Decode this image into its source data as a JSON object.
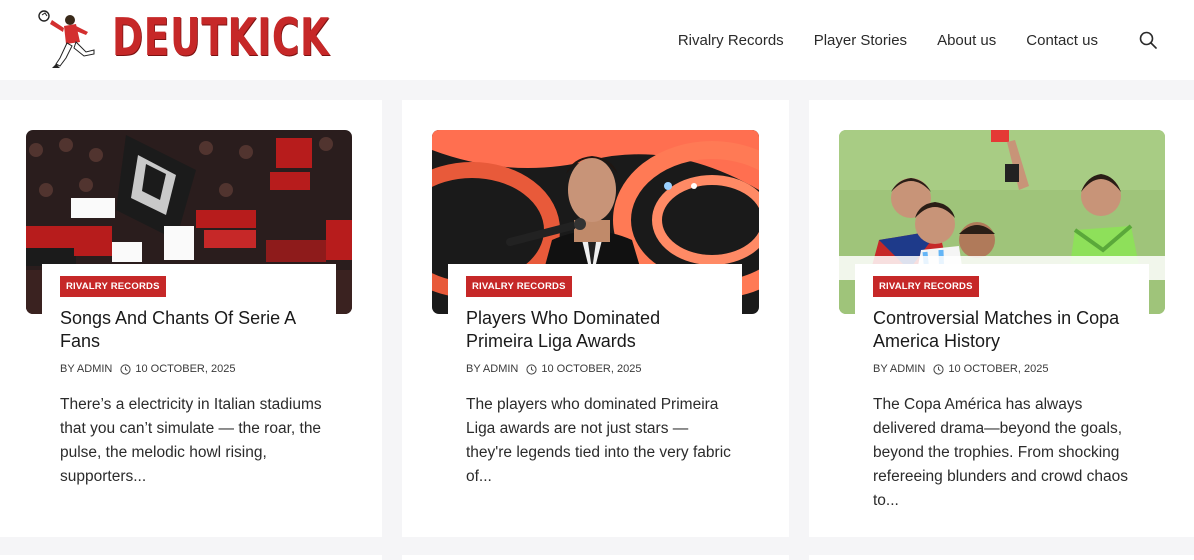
{
  "header": {
    "logo_text": "DEUTKICK",
    "nav": [
      {
        "label": "Rivalry Records"
      },
      {
        "label": "Player Stories"
      },
      {
        "label": "About us"
      },
      {
        "label": "Contact us"
      }
    ],
    "search_icon": "search-icon"
  },
  "colors": {
    "accent": "#c62828",
    "background": "#f5f5f7",
    "card": "#ffffff"
  },
  "posts": [
    {
      "category": "RIVALRY RECORDS",
      "title": "Songs And Chants Of Serie A Fans",
      "author": "BY ADMIN",
      "date": "10 OCTOBER, 2025",
      "excerpt": "There’s a electricity in Italian stadiums that you can’t simulate — the roar, the pulse, the melodic howl rising, supporters...",
      "image": "stadium-fans-banners"
    },
    {
      "category": "RIVALRY RECORDS",
      "title": "Players Who Dominated Primeira Liga Awards",
      "author": "BY ADMIN",
      "date": "10 OCTOBER, 2025",
      "excerpt": "The players who dominated Primeira Liga awards are not just stars — they're legends tied into the very fabric of...",
      "image": "player-speech-podium"
    },
    {
      "category": "RIVALRY RECORDS",
      "title": "Controversial Matches in Copa America History",
      "author": "BY ADMIN",
      "date": "10 OCTOBER, 2025",
      "excerpt": "The Copa América has always delivered drama—beyond the goals, beyond the trophies. From shocking refereeing blunders and crowd chaos to...",
      "image": "referee-red-card"
    }
  ]
}
